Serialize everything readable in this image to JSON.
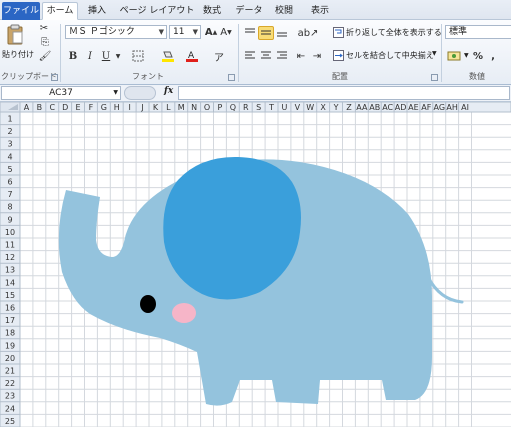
{
  "ribbon_tabs": [
    {
      "label": "ファイル"
    },
    {
      "label": "ホーム"
    },
    {
      "label": "挿入"
    },
    {
      "label": "ページ レイアウト"
    },
    {
      "label": "数式"
    },
    {
      "label": "データ"
    },
    {
      "label": "校閲"
    },
    {
      "label": "表示"
    }
  ],
  "clipboard": {
    "paste_label": "貼り付け",
    "group_label": "クリップボード"
  },
  "font": {
    "family": "ＭＳ Ｐゴシック",
    "size": "11",
    "group_label": "フォント",
    "bold": "B",
    "italic": "I",
    "underline": "U"
  },
  "alignment": {
    "wrap_text": "折り返して全体を表示する",
    "merge_center": "セルを結合して中央揃え",
    "group_label": "配置"
  },
  "number": {
    "format": "標準",
    "percent": "%",
    "comma": ",",
    "group_label": "数値"
  },
  "formula_bar": {
    "name_box": "AC37",
    "fx": "fx"
  },
  "sheet": {
    "column_headers": [
      "A",
      "B",
      "C",
      "D",
      "E",
      "F",
      "G",
      "H",
      "I",
      "J",
      "K",
      "L",
      "M",
      "N",
      "O",
      "P",
      "Q",
      "R",
      "S",
      "T",
      "U",
      "V",
      "W",
      "X",
      "Y",
      "Z",
      "AA",
      "AB",
      "AC",
      "AD",
      "AE",
      "AF",
      "AG",
      "AH",
      "AI"
    ],
    "row_headers": [
      "1",
      "2",
      "3",
      "4",
      "5",
      "6",
      "7",
      "8",
      "9",
      "10",
      "11",
      "12",
      "13",
      "14",
      "15",
      "16",
      "17",
      "18",
      "19",
      "20",
      "21",
      "22",
      "23",
      "24",
      "25"
    ]
  },
  "colors": {
    "elephant_body": "#94c3dd",
    "elephant_ear": "#3a9fdb",
    "elephant_eye": "#000000",
    "elephant_cheek": "#f6b5c8",
    "grid_line": "#d4d8de",
    "header_bg": "#e6ecf4",
    "active_tab_bg": "#ffffff",
    "file_tab_bg": "#2b66c4"
  }
}
